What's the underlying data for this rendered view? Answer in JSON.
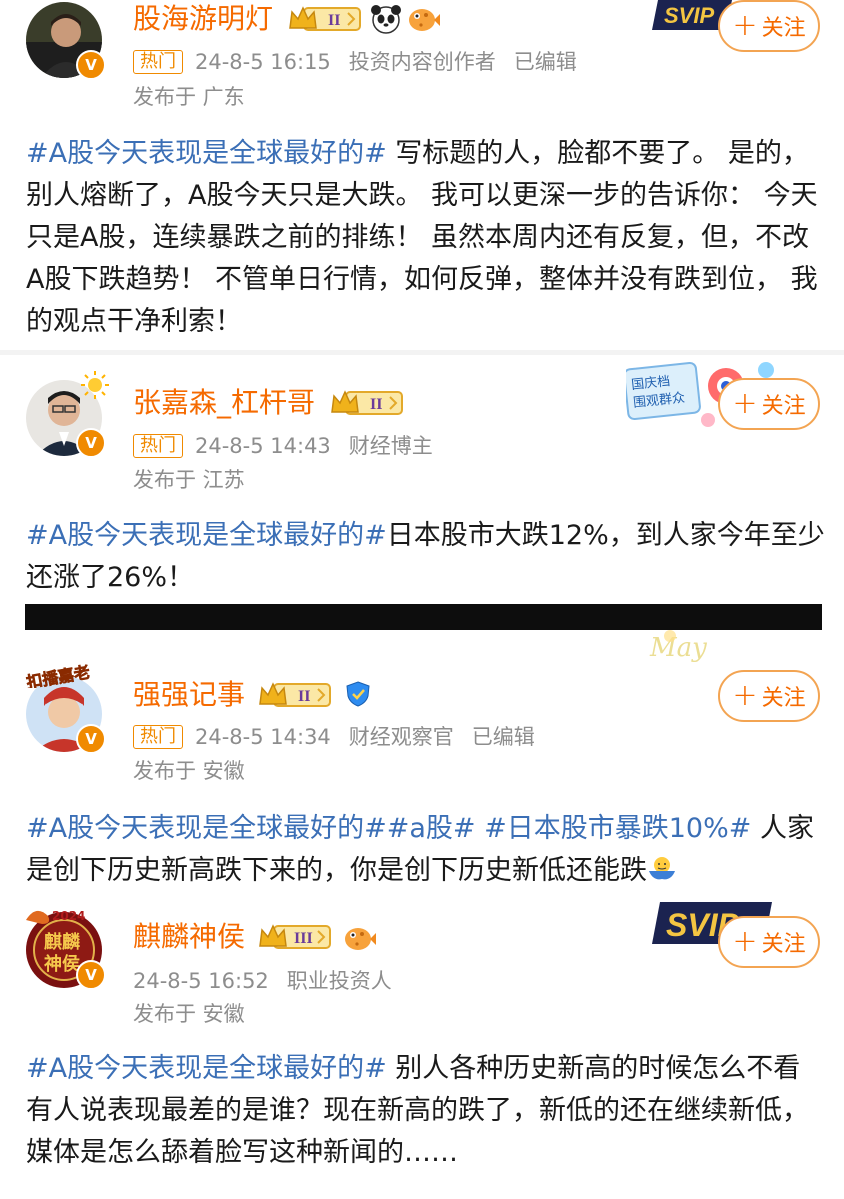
{
  "posts": [
    {
      "username": "股海游明灯",
      "level": "II",
      "hot_badge": "热门",
      "time": "24-8-5 16:15",
      "role": "投资内容创作者",
      "edited": "已编辑",
      "location": "发布于 广东",
      "follow_label": "关注",
      "body": [
        {
          "tag": "#A股今天表现是全球最好的#"
        },
        {
          "text": "  写标题的人，脸都不要了。 是的，别人熔断了，A股今天只是大跌。 我可以更深一步的告诉你： 今天只是A股，连续暴跌之前的排练！ 虽然本周内还有反复，但，不改A股下跌趋势！ 不管单日行情，如何反弹，整体并没有跌到位， 我的观点干净利索！"
        }
      ]
    },
    {
      "username": "张嘉森_杠杆哥",
      "level": "II",
      "hot_badge": "热门",
      "time": "24-8-5 14:43",
      "role": "财经博主",
      "location": "发布于 江苏",
      "follow_label": "关注",
      "banner_text": "国庆档 围观群众",
      "body": [
        {
          "tag": "#A股今天表现是全球最好的#"
        },
        {
          "text": "日本股市大跌12%，到人家今年至少还涨了26%！"
        }
      ]
    },
    {
      "username": "强强记事",
      "level": "II",
      "hot_badge": "热门",
      "time": "24-8-5 14:34",
      "role": "财经观察官",
      "edited": "已编辑",
      "location": "发布于 安徽",
      "follow_label": "关注",
      "avatar_text": "扣播嘉老",
      "body": [
        {
          "tag": "#A股今天表现是全球最好的##a股# #日本股市暴跌10%#"
        },
        {
          "text": " 人家是创下历史新高跌下来的，你是创下历史新低还能跌"
        }
      ]
    },
    {
      "username": "麒麟神侯",
      "level": "III",
      "time": "24-8-5 16:52",
      "role": "职业投资人",
      "location": "发布于 安徽",
      "follow_label": "关注",
      "avatar_text": "麒麟神侯",
      "body": [
        {
          "tag": "#A股今天表现是全球最好的#"
        },
        {
          "text": " 别人各种历史新高的时候怎么不看有人说表现最差的是谁？现在新高的跌了，新低的还在继续新低，媒体是怎么舔着脸写这种新闻的……"
        }
      ]
    }
  ],
  "colors": {
    "username": "#f56a00",
    "tag": "#3b6fb6",
    "meta": "#8d8d8d",
    "follow_border": "#f3a452"
  },
  "icons": [
    "verified-v-icon",
    "crown-level-icon",
    "panda-emoji-icon",
    "pufferfish-emoji-icon",
    "shield-badge-icon",
    "shrug-emoji-icon",
    "svip-badge-icon",
    "sun-icon"
  ]
}
